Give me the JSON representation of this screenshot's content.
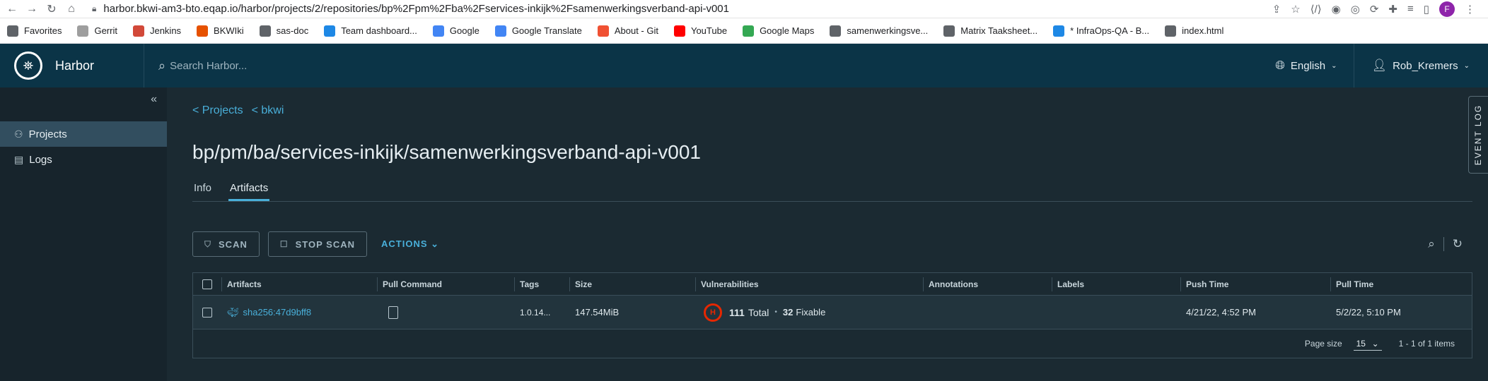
{
  "browser": {
    "url": "harbor.bkwi-am3-bto.eqap.io/harbor/projects/2/repositories/bp%2Fpm%2Fba%2Fservices-inkijk%2Fsamenwerkingsverband-api-v001",
    "profile_initial": "F"
  },
  "bookmarks": [
    {
      "label": "Favorites",
      "icon": "folder-icon",
      "color": "#5f6368"
    },
    {
      "label": "Gerrit",
      "icon": "gerrit-icon",
      "color": "#9e9e9e"
    },
    {
      "label": "Jenkins",
      "icon": "jenkins-icon",
      "color": "#d24939"
    },
    {
      "label": "BKWIki",
      "icon": "bkwiki-icon",
      "color": "#e65100"
    },
    {
      "label": "sas-doc",
      "icon": "globe-icon",
      "color": "#5f6368"
    },
    {
      "label": "Team dashboard...",
      "icon": "diamond-icon",
      "color": "#1e88e5"
    },
    {
      "label": "Google",
      "icon": "google-icon",
      "color": "#4285f4"
    },
    {
      "label": "Google Translate",
      "icon": "translate-icon",
      "color": "#4285f4"
    },
    {
      "label": "About - Git",
      "icon": "git-icon",
      "color": "#f05133"
    },
    {
      "label": "YouTube",
      "icon": "youtube-icon",
      "color": "#ff0000"
    },
    {
      "label": "Google Maps",
      "icon": "maps-icon",
      "color": "#34a853"
    },
    {
      "label": "samenwerkingsve...",
      "icon": "globe-icon",
      "color": "#5f6368"
    },
    {
      "label": "Matrix Taaksheet...",
      "icon": "globe-icon",
      "color": "#5f6368"
    },
    {
      "label": "* InfraOps-QA - B...",
      "icon": "infraops-icon",
      "color": "#1e88e5"
    },
    {
      "label": "index.html",
      "icon": "globe-icon",
      "color": "#5f6368"
    }
  ],
  "header": {
    "brand": "Harbor",
    "search_placeholder": "Search Harbor...",
    "language": "English",
    "user": "Rob_Kremers"
  },
  "sidebar": {
    "items": [
      {
        "label": "Projects",
        "icon": "projects-icon",
        "active": true
      },
      {
        "label": "Logs",
        "icon": "logs-icon",
        "active": false
      }
    ]
  },
  "breadcrumbs": [
    "< Projects",
    "< bkwi"
  ],
  "repo_title": "bp/pm/ba/services-inkijk/samenwerkingsverband-api-v001",
  "tabs": [
    {
      "label": "Info",
      "active": false
    },
    {
      "label": "Artifacts",
      "active": true
    }
  ],
  "toolbar": {
    "scan": "SCAN",
    "stop_scan": "STOP SCAN",
    "actions": "ACTIONS"
  },
  "table": {
    "columns": [
      "Artifacts",
      "Pull Command",
      "Tags",
      "Size",
      "Vulnerabilities",
      "Annotations",
      "Labels",
      "Push Time",
      "Pull Time"
    ],
    "rows": [
      {
        "artifact": "sha256:47d9bff8",
        "tags": "1.0.14...",
        "size": "147.54MiB",
        "severity": "H",
        "vuln_total": "111",
        "vuln_total_label": "Total",
        "vuln_fixable": "32",
        "vuln_fixable_label": "Fixable",
        "annotations": "",
        "labels": "",
        "push_time": "4/21/22, 4:52 PM",
        "pull_time": "5/2/22, 5:10 PM"
      }
    ],
    "footer": {
      "page_size_label": "Page size",
      "page_size": "15",
      "range": "1 - 1 of 1 items"
    }
  },
  "event_log": "EVENT LOG",
  "colors": {
    "header_bg": "#0b3447",
    "sidebar_bg": "#17242c",
    "main_bg": "#1b2a32",
    "link": "#49afd9",
    "severity_high": "#e62700"
  }
}
